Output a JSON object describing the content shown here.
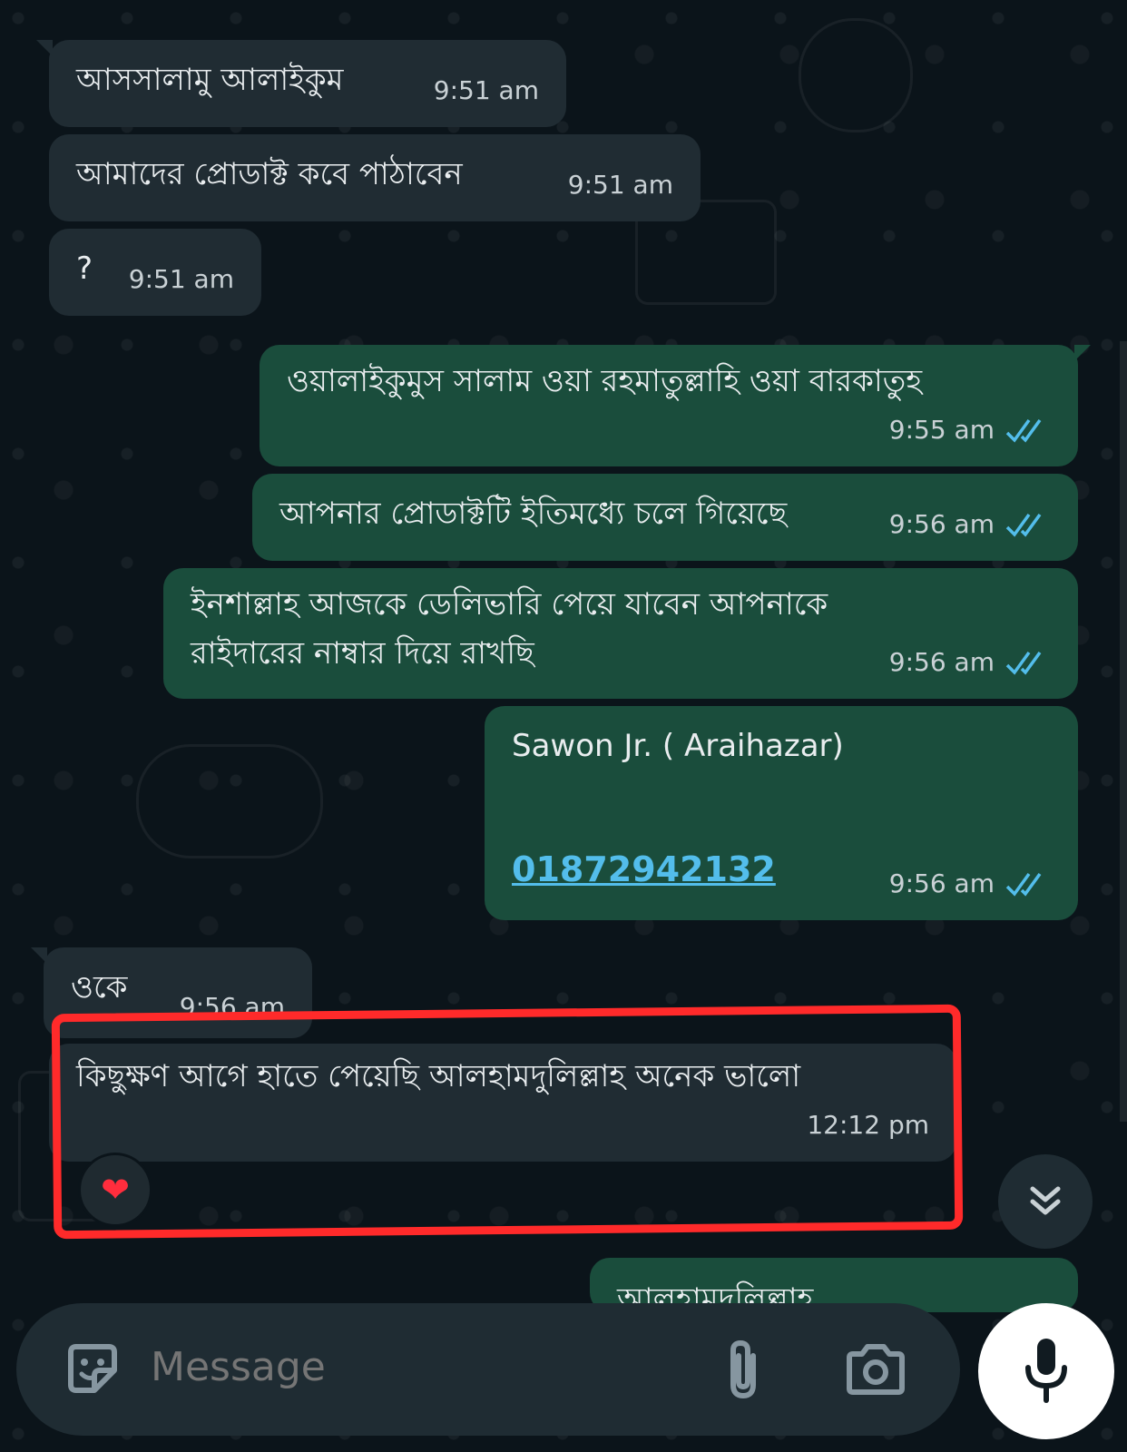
{
  "chat": {
    "messages": [
      {
        "dir": "in",
        "text": "আসসালামু আলাইকুম",
        "time": "9:51 am"
      },
      {
        "dir": "in",
        "text": "আমাদের প্রোডাক্ট কবে পাঠাবেন",
        "time": "9:51 am"
      },
      {
        "dir": "in",
        "text": "?",
        "time": "9:51 am"
      },
      {
        "dir": "out",
        "text": "ওয়ালাইকুমুস সালাম ওয়া রহমাতুল্লাহি ওয়া বারকাতুহ",
        "time": "9:55 am"
      },
      {
        "dir": "out",
        "text": "আপনার প্রোডাক্টটি ইতিমধ্যে চলে গিয়েছে",
        "time": "9:56 am"
      },
      {
        "dir": "out",
        "text_line1": "ইনশাল্লাহ আজকে ডেলিভারি পেয়ে যাবেন আপনাকে",
        "text_line2": "রাইদারের নাম্বার দিয়ে রাখছি",
        "time": "9:56 am"
      },
      {
        "dir": "out",
        "contact_name": "Sawon Jr. ( Araihazar)",
        "phone": "01872942132",
        "time": "9:56 am"
      },
      {
        "dir": "in",
        "text": "ওকে",
        "time": "9:56 am"
      },
      {
        "dir": "in",
        "text": "কিছুক্ষণ আগে হাতে পেয়েছি আলহামদুলিল্লাহ অনেক ভালো",
        "time": "12:12 pm",
        "reaction": "❤"
      }
    ],
    "partial_out_text": "আলহামদুলিল্লাহ"
  },
  "input": {
    "placeholder": "Message",
    "sticker_icon": "sticker-icon",
    "attach_icon": "paperclip-icon",
    "camera_icon": "camera-icon",
    "mic_icon": "mic-icon"
  },
  "colors": {
    "background": "#0b141a",
    "incoming_bubble": "#202c33",
    "outgoing_bubble": "#1a4d3c",
    "read_ticks": "#53bdeb",
    "highlight": "#ff2a2a"
  }
}
